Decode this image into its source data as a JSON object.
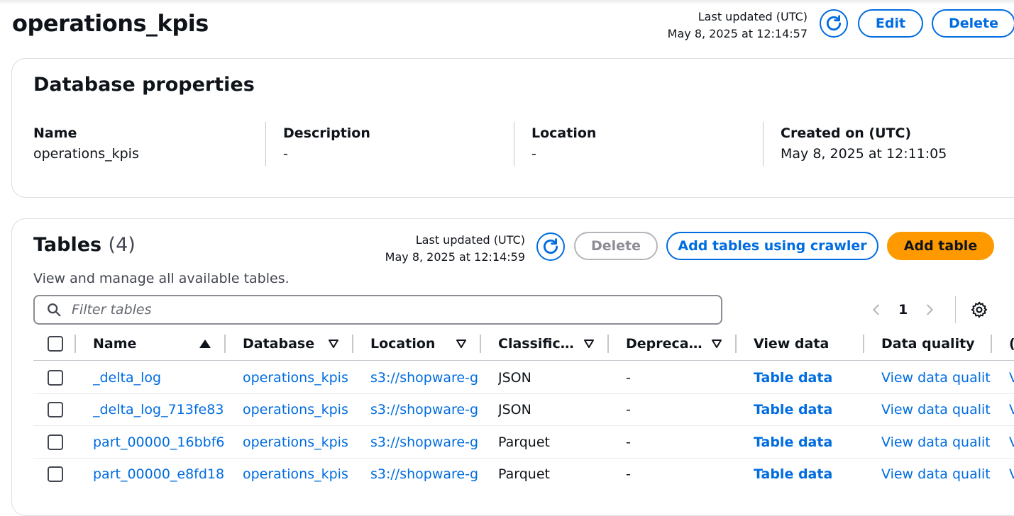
{
  "header": {
    "title": "operations_kpis",
    "last_updated_label": "Last updated (UTC)",
    "last_updated_value": "May 8, 2025 at 12:14:57",
    "edit_label": "Edit",
    "delete_label": "Delete"
  },
  "properties": {
    "title": "Database properties",
    "items": [
      {
        "key": "Name",
        "value": "operations_kpis"
      },
      {
        "key": "Description",
        "value": "-"
      },
      {
        "key": "Location",
        "value": "-"
      },
      {
        "key": "Created on (UTC)",
        "value": "May 8, 2025 at 12:11:05"
      }
    ]
  },
  "tables": {
    "title": "Tables",
    "count": "(4)",
    "description": "View and manage all available tables.",
    "last_updated_label": "Last updated (UTC)",
    "last_updated_value": "May 8, 2025 at 12:14:59",
    "delete_label": "Delete",
    "crawler_label": "Add tables using crawler",
    "add_label": "Add table",
    "filter_placeholder": "Filter tables",
    "page": "1",
    "columns": [
      "Name",
      "Database",
      "Location",
      "Classific…",
      "Depreca…",
      "View data",
      "Data quality",
      "("
    ],
    "rows": [
      {
        "name": "_delta_log",
        "database": "operations_kpis",
        "location": "s3://shopware-g",
        "classification": "JSON",
        "deprecated": "-",
        "view_data": "Table data",
        "data_quality": "View data qualit",
        "extra": "V"
      },
      {
        "name": "_delta_log_713fe83",
        "database": "operations_kpis",
        "location": "s3://shopware-g",
        "classification": "JSON",
        "deprecated": "-",
        "view_data": "Table data",
        "data_quality": "View data qualit",
        "extra": "V"
      },
      {
        "name": "part_00000_16bbf6",
        "database": "operations_kpis",
        "location": "s3://shopware-g",
        "classification": "Parquet",
        "deprecated": "-",
        "view_data": "Table data",
        "data_quality": "View data qualit",
        "extra": "V"
      },
      {
        "name": "part_00000_e8fd18",
        "database": "operations_kpis",
        "location": "s3://shopware-g",
        "classification": "Parquet",
        "deprecated": "-",
        "view_data": "Table data",
        "data_quality": "View data qualit",
        "extra": "V"
      }
    ]
  },
  "colors": {
    "accent": "#006ce0",
    "primary": "#ff9900",
    "text": "#0f141a"
  },
  "icons": [
    "refresh-icon",
    "search-icon",
    "chevron-left-icon",
    "chevron-right-icon",
    "settings-icon",
    "sort-ascending-icon",
    "sort-descending-icon"
  ]
}
